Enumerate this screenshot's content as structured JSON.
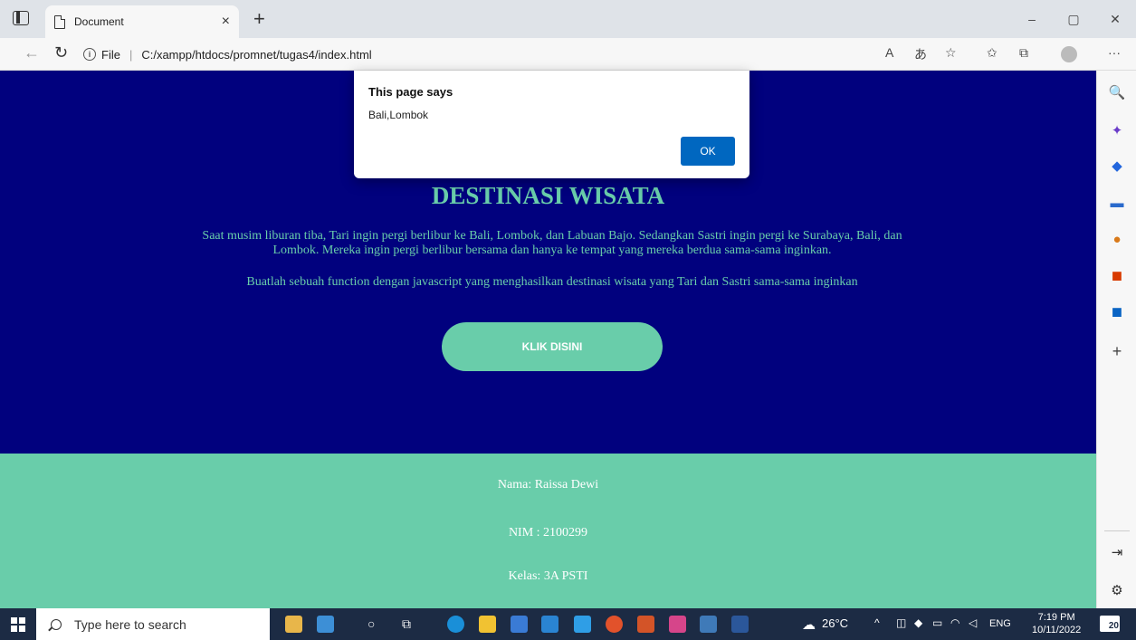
{
  "browser": {
    "tab_title": "Document",
    "tab_close": "×",
    "new_tab": "+",
    "address_scheme": "File",
    "address_url": "C:/xampp/htdocs/promnet/tugas4/index.html",
    "minimize": "–",
    "restore": "▢",
    "close": "✕"
  },
  "page": {
    "heading": "DESTINASI WISATA",
    "paragraph1": "Saat musim liburan tiba, Tari ingin pergi berlibur ke Bali, Lombok, dan Labuan Bajo. Sedangkan Sastri ingin pergi ke Surabaya, Bali, dan Lombok. Mereka ingin pergi berlibur bersama dan hanya ke tempat yang mereka berdua sama-sama inginkan.",
    "paragraph2": "Buatlah sebuah function dengan javascript yang menghasilkan destinasi wisata yang Tari dan Sastri sama-sama inginkan",
    "button_label": "KLIK DISINI",
    "footer": {
      "name": "Nama: Raissa Dewi",
      "nim": "NIM : 2100299",
      "kelas": "Kelas: 3A PSTI"
    }
  },
  "dialog": {
    "title": "This page says",
    "message": "Bali,Lombok",
    "ok_label": "OK"
  },
  "taskbar": {
    "search_placeholder": "Type here to search",
    "weather": "26°C",
    "language": "ENG",
    "time": "7:19 PM",
    "date": "10/11/2022",
    "notification_count": "20"
  },
  "colors": {
    "hero_bg": "#01017e",
    "accent": "#69cdaa",
    "dialog_button": "#0067c0",
    "taskbar_bg": "#1c2b44"
  }
}
